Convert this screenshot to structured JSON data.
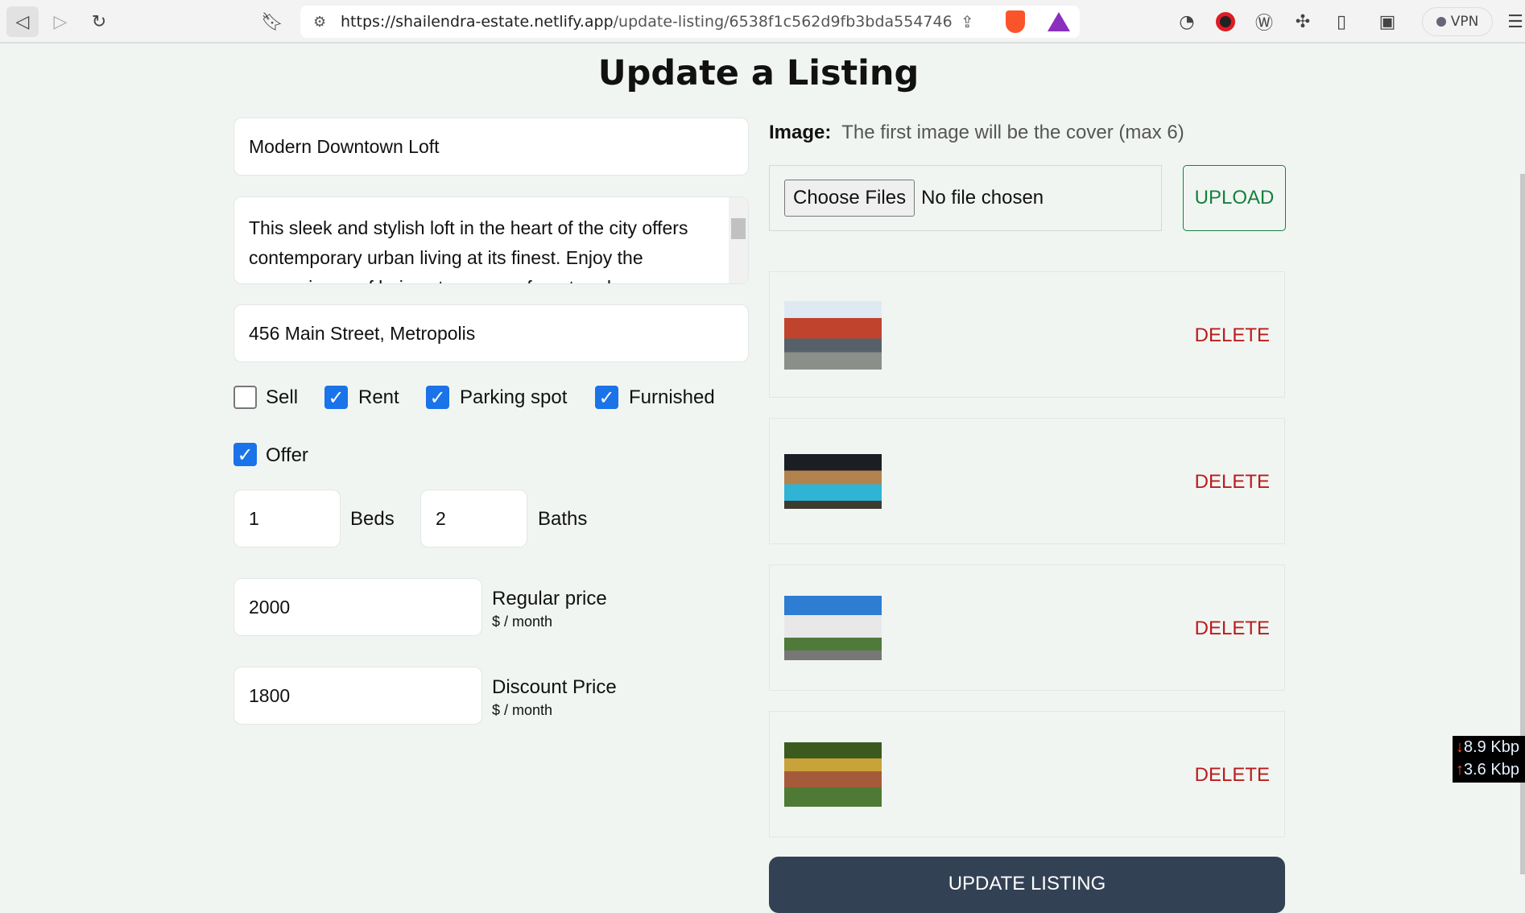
{
  "browser": {
    "url_host": "https://shailendra-estate.netlify.app",
    "url_path": "/update-listing/6538f1c562d9fb3bda554746",
    "vpn_label": "VPN"
  },
  "page": {
    "title": "Update a Listing"
  },
  "form": {
    "name": "Modern Downtown Loft",
    "description": "This sleek and stylish loft in the heart of the city offers contemporary urban living at its finest. Enjoy the convenience of being steps away from trendy",
    "address": "456 Main Street, Metropolis",
    "checkboxes": [
      {
        "label": "Sell",
        "checked": false
      },
      {
        "label": "Rent",
        "checked": true
      },
      {
        "label": "Parking spot",
        "checked": true
      },
      {
        "label": "Furnished",
        "checked": true
      },
      {
        "label": "Offer",
        "checked": true
      }
    ],
    "beds": "1",
    "beds_label": "Beds",
    "baths": "2",
    "baths_label": "Baths",
    "regular_price": "2000",
    "regular_price_label": "Regular price",
    "regular_price_unit": "$ / month",
    "discount_price": "1800",
    "discount_price_label": "Discount Price",
    "discount_price_unit": "$ / month"
  },
  "images": {
    "label": "Image:",
    "hint": "The first image will be the cover (max 6)",
    "choose_files": "Choose Files",
    "no_file": "No file chosen",
    "upload": "UPLOAD",
    "items": [
      {
        "delete": "DELETE"
      },
      {
        "delete": "DELETE"
      },
      {
        "delete": "DELETE"
      },
      {
        "delete": "DELETE"
      }
    ]
  },
  "submit": "UPDATE LISTING",
  "net_overlay": {
    "down": "8.9 Kbp",
    "up": "3.6 Kbp"
  },
  "colors": {
    "upload": "#15803d",
    "delete": "#b91c1c",
    "submit_bg": "#334155",
    "checkbox": "#1a73e8"
  }
}
